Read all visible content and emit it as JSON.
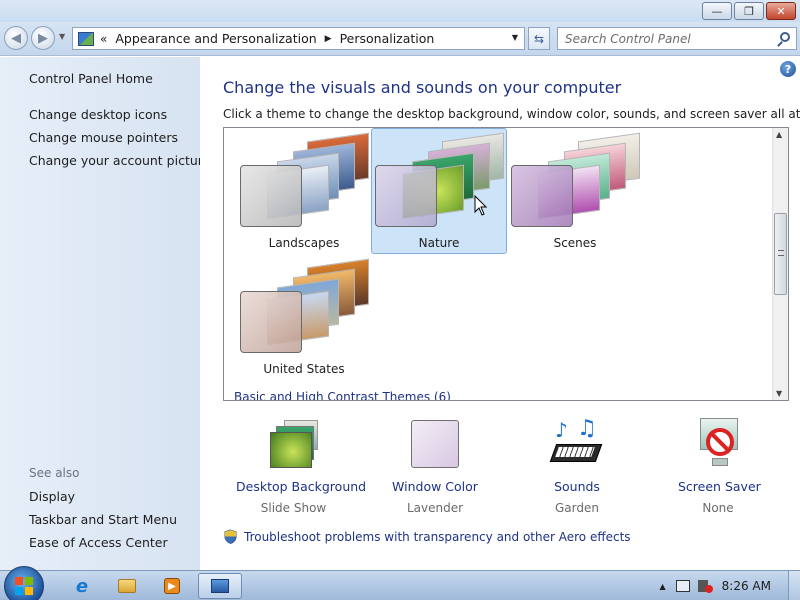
{
  "window": {
    "controls": {
      "minimize": "—",
      "maximize": "❐",
      "close": "✕"
    }
  },
  "navbar": {
    "back_glyph": "◀",
    "forward_glyph": "▶",
    "address": {
      "prefix": "«",
      "crumbs": [
        "Appearance and Personalization",
        "Personalization"
      ],
      "separator": "▶",
      "dropdown": "▼"
    },
    "refresh_glyph": "⇆",
    "search": {
      "placeholder": "Search Control Panel",
      "value": ""
    }
  },
  "sidebar": {
    "home": "Control Panel Home",
    "links": [
      "Change desktop icons",
      "Change mouse pointers",
      "Change your account picture"
    ],
    "see_also_label": "See also",
    "see_also": [
      "Display",
      "Taskbar and Start Menu",
      "Ease of Access Center"
    ]
  },
  "main": {
    "help_glyph": "?",
    "heading": "Change the visuals and sounds on your computer",
    "subheading": "Click a theme to change the desktop background, window color, sounds, and screen saver all at once.",
    "themes": [
      {
        "name": "Landscapes",
        "selected": false
      },
      {
        "name": "Nature",
        "selected": true
      },
      {
        "name": "Scenes",
        "selected": false
      },
      {
        "name": "United States",
        "selected": false
      }
    ],
    "next_group_label": "Basic and High Contrast Themes (6)",
    "options": [
      {
        "title": "Desktop Background",
        "value": "Slide Show",
        "icon": "desktop-background-icon"
      },
      {
        "title": "Window Color",
        "value": "Lavender",
        "icon": "window-color-icon"
      },
      {
        "title": "Sounds",
        "value": "Garden",
        "icon": "sounds-icon"
      },
      {
        "title": "Screen Saver",
        "value": "None",
        "icon": "screen-saver-icon"
      }
    ],
    "troubleshoot": "Troubleshoot problems with transparency and other Aero effects"
  },
  "taskbar": {
    "tray_up": "▲",
    "clock": "8:26 AM"
  },
  "colors": {
    "link": "#1e3287",
    "selection": "#cde3f7",
    "sidebar": "#dce7f4"
  }
}
